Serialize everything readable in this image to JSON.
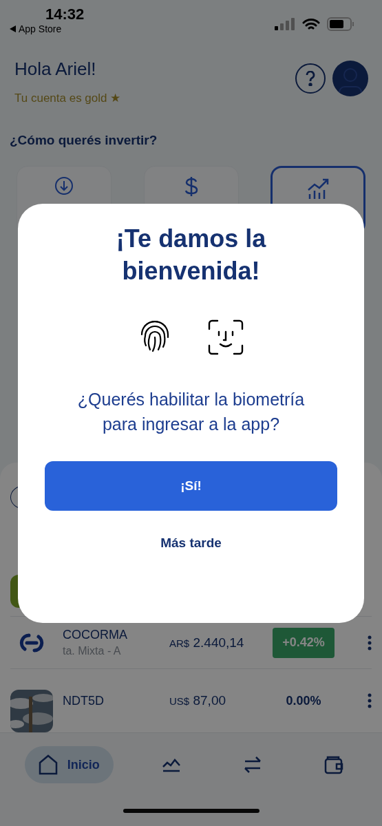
{
  "status_bar": {
    "time": "14:32",
    "back_label": "App Store"
  },
  "header": {
    "greeting": "Hola Ariel!",
    "tier": "Tu cuenta es gold ★"
  },
  "invest": {
    "title": "¿Cómo querés invertir?",
    "options": [
      {
        "kind": "deposit",
        "selected": false
      },
      {
        "kind": "dollar",
        "selected": false
      },
      {
        "kind": "chart",
        "selected": true
      }
    ]
  },
  "holdings": [
    {
      "kind": "logo",
      "name": "COCORMA",
      "subtitle": "ta. Mixta - A",
      "currency": "AR$",
      "price": "2.440,14",
      "change": {
        "text": "+0.42%",
        "kind": "up"
      }
    },
    {
      "kind": "picture",
      "name": "NDT5D",
      "currency": "US$",
      "price": "87,00",
      "change": {
        "text": "0.00%",
        "kind": "flat"
      }
    }
  ],
  "nav": [
    {
      "kind": "home",
      "label": "Inicio",
      "selected": true
    },
    {
      "kind": "market",
      "selected": false
    },
    {
      "kind": "transfer",
      "selected": false
    },
    {
      "kind": "wallet",
      "selected": false
    }
  ],
  "dialog": {
    "title": "¡Te damos la bienvenida!",
    "question": "¿Querés habilitar la biometría para ingresar a la app?",
    "confirm": "¡Sí!",
    "later": "Más tarde"
  }
}
